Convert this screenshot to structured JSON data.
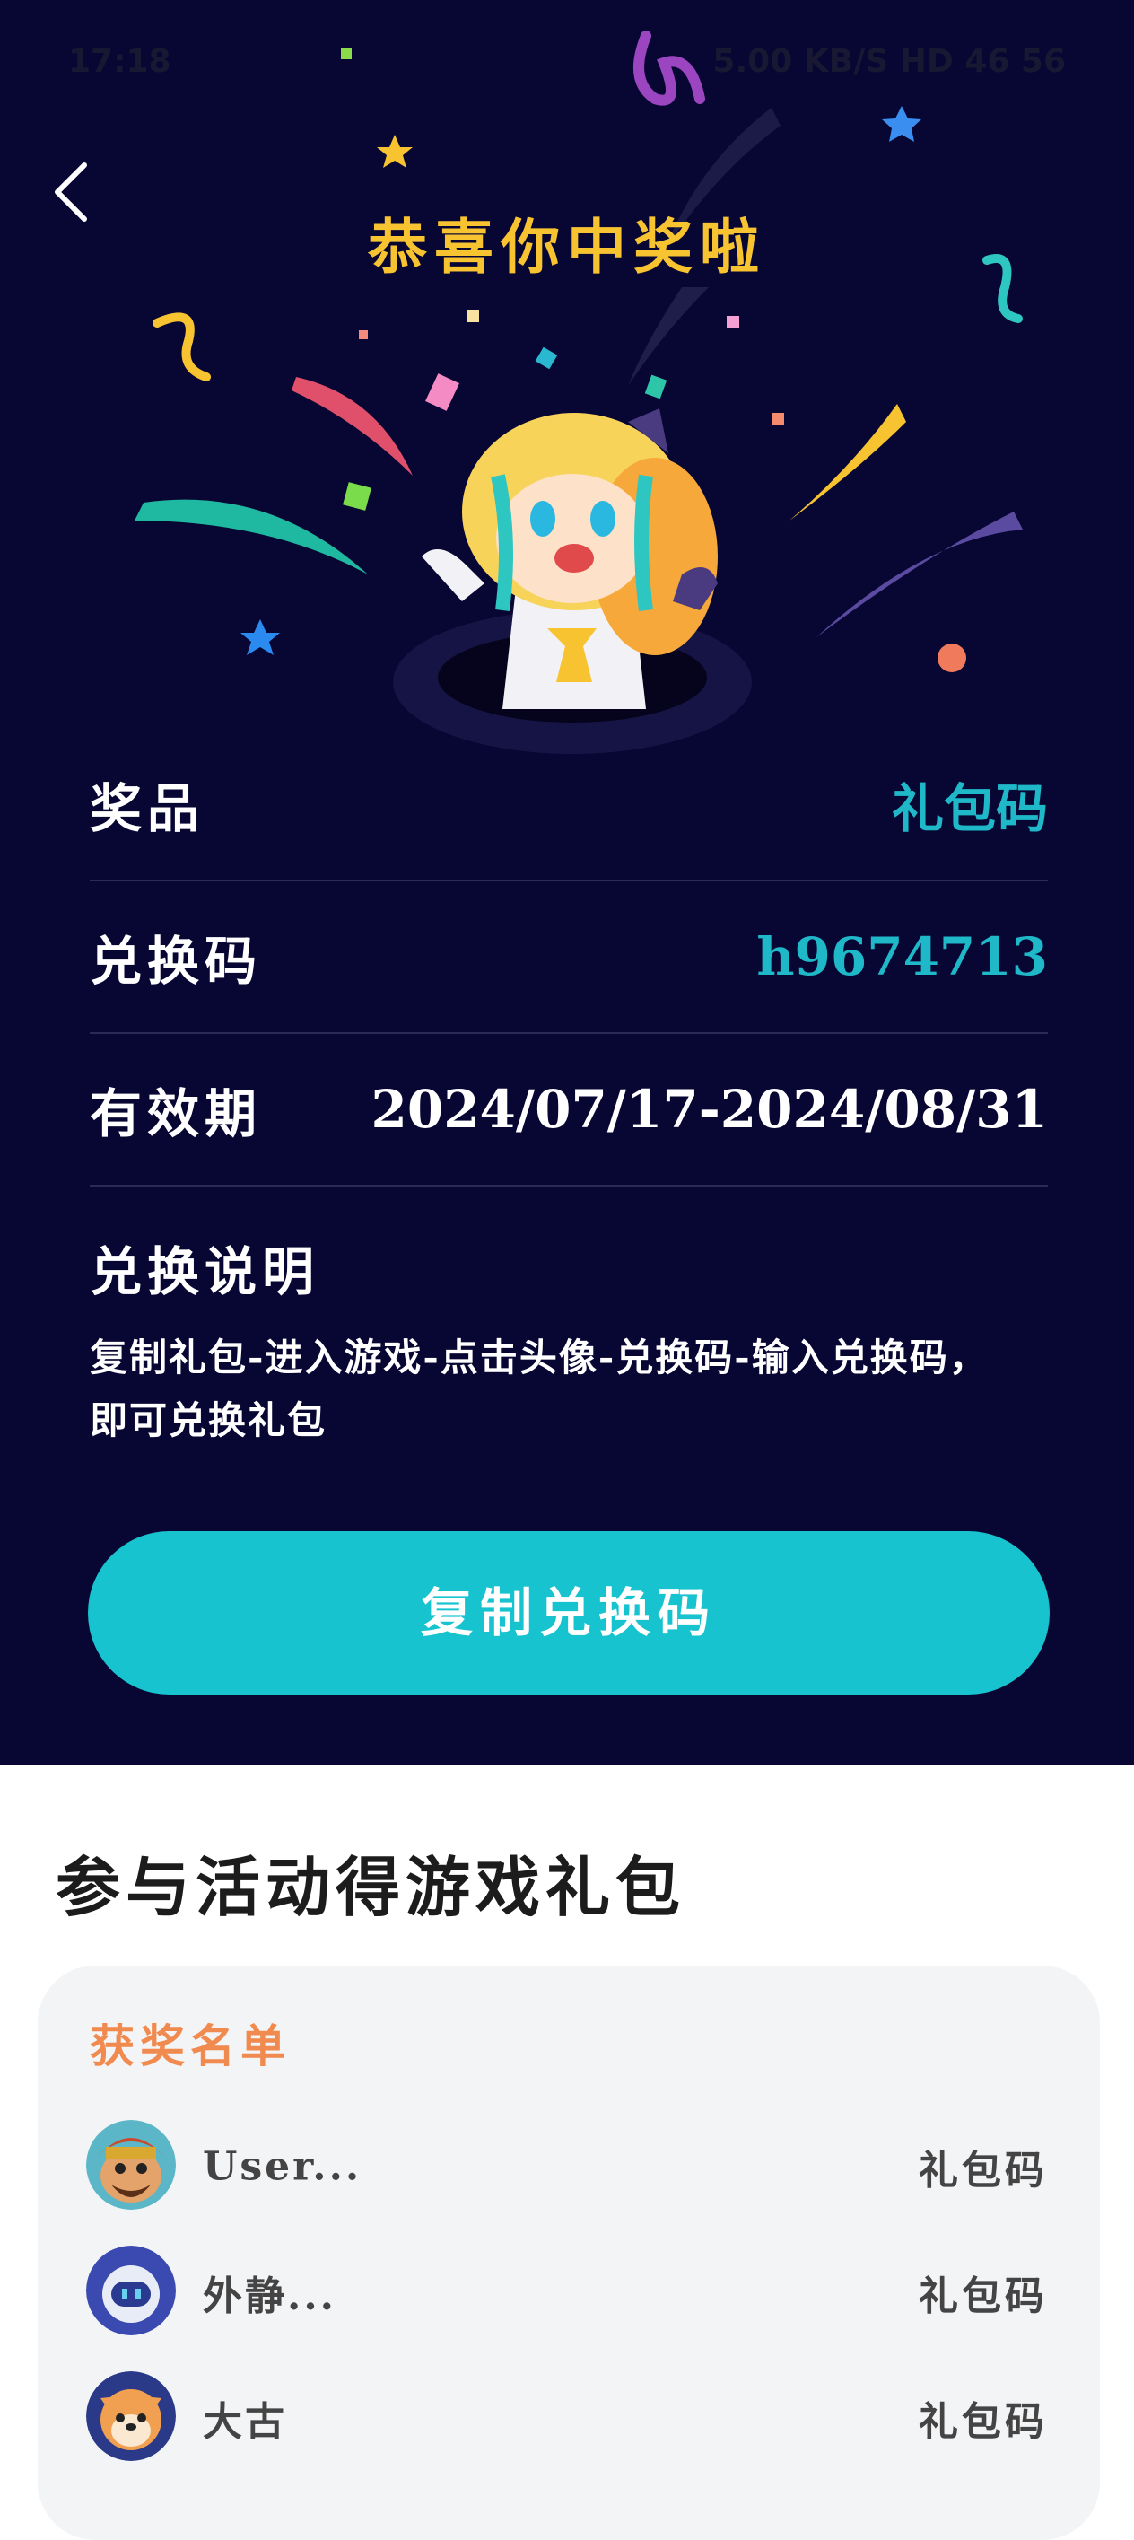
{
  "status_bar": {
    "time": "17:18",
    "icons_text": "5.00 KB/S  HD  46  56"
  },
  "header": {
    "title": "恭喜你中奖啦"
  },
  "prize": {
    "rows": [
      {
        "label": "奖品",
        "value": "礼包码"
      },
      {
        "label": "兑换码",
        "value": "h9674713"
      },
      {
        "label": "有效期",
        "value": "2024/07/17-2024/08/31"
      }
    ],
    "instructions_label": "兑换说明",
    "instructions_text": "复制礼包-进入游戏-点击头像-兑换码-输入兑换码，即可兑换礼包",
    "copy_button": "复制兑换码"
  },
  "activity": {
    "section_title": "参与活动得游戏礼包",
    "winners_title": "获奖名单",
    "winners": [
      {
        "name": "User...",
        "prize": "礼包码"
      },
      {
        "name": "外静...",
        "prize": "礼包码"
      },
      {
        "name": "大古",
        "prize": "礼包码"
      }
    ]
  },
  "colors": {
    "background": "#080633",
    "accent": "#17c3cf",
    "title": "#f7c331",
    "winners_title": "#f08a4f"
  }
}
